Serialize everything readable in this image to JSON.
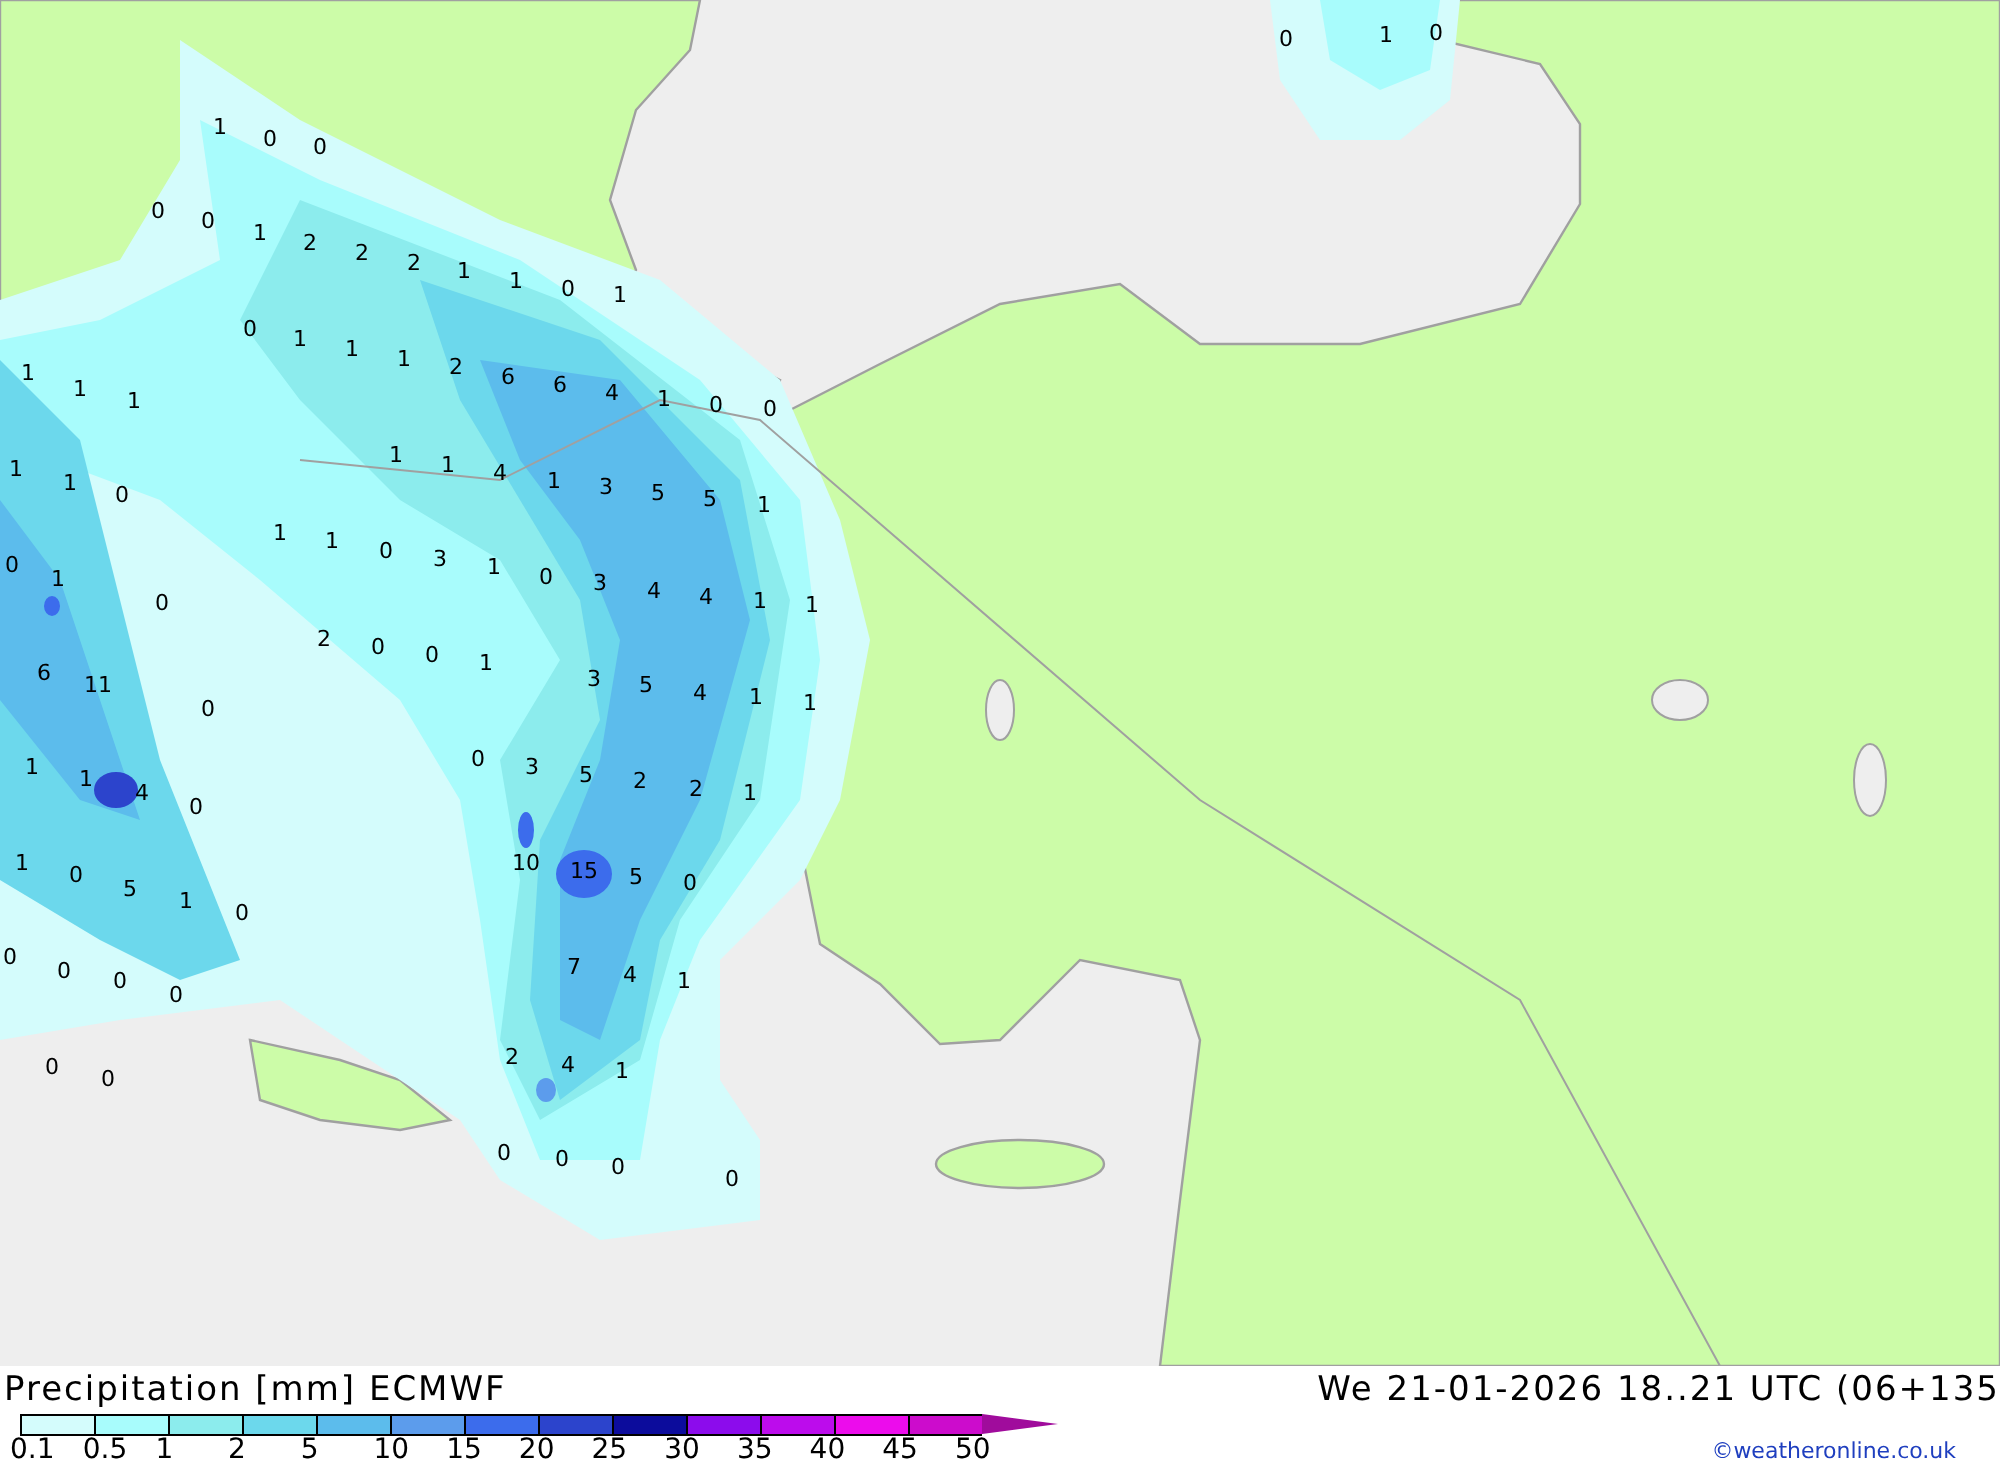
{
  "map": {
    "value_labels": [
      "0",
      "1",
      "0",
      "1",
      "0",
      "0",
      "0",
      "0",
      "1",
      "2",
      "2",
      "2",
      "1",
      "1",
      "0",
      "1",
      "0",
      "1",
      "1",
      "1",
      "2",
      "6",
      "6",
      "4",
      "1",
      "0",
      "0",
      "1",
      "1",
      "1",
      "1",
      "1",
      "4",
      "1",
      "3",
      "5",
      "5",
      "1",
      "1",
      "1",
      "0",
      "1",
      "1",
      "0",
      "3",
      "1",
      "0",
      "3",
      "4",
      "4",
      "1",
      "1",
      "0",
      "1",
      "0",
      "2",
      "0",
      "0",
      "1",
      "3",
      "5",
      "4",
      "1",
      "1",
      "6",
      "11",
      "0",
      "1",
      "1",
      "4",
      "0",
      "0",
      "3",
      "5",
      "2",
      "2",
      "1",
      "1",
      "0",
      "5",
      "1",
      "0",
      "10",
      "15",
      "5",
      "0",
      "0",
      "0",
      "0",
      "0",
      "7",
      "4",
      "1",
      "0",
      "0",
      "2",
      "4",
      "1",
      "0",
      "0",
      "0",
      "0"
    ]
  },
  "legend": {
    "title": "Precipitation [mm] ECMWF",
    "swatches": [
      {
        "kind": "box",
        "color": "#d4fcfc"
      },
      {
        "kind": "box",
        "color": "#a8fcfc"
      },
      {
        "kind": "box",
        "color": "#8ceced"
      },
      {
        "kind": "box",
        "color": "#6cd8ec"
      },
      {
        "kind": "box",
        "color": "#5cbcec"
      },
      {
        "kind": "box",
        "color": "#5c9cec"
      },
      {
        "kind": "box",
        "color": "#3c6cec"
      },
      {
        "kind": "box",
        "color": "#2c44cc"
      },
      {
        "kind": "box",
        "color": "#0c0c9c"
      },
      {
        "kind": "box",
        "color": "#8c0cec"
      },
      {
        "kind": "box",
        "color": "#bc0cec"
      },
      {
        "kind": "box",
        "color": "#ec0cec"
      },
      {
        "kind": "box",
        "color": "#cc0ccc"
      },
      {
        "kind": "arrow",
        "color": "#a00c9c"
      }
    ],
    "scale_labels": "0.1 0.5 1 2 5 10 15 20 25 30 35 40 45 50"
  },
  "valid_time": "We 21-01-2026 18..21 UTC (06+135",
  "credit": "©weatheronline.co.uk"
}
